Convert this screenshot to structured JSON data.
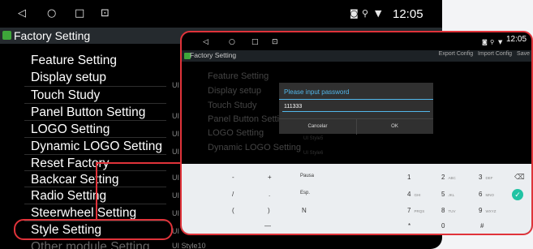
{
  "statusbar": {
    "nav_icons": [
      "◁",
      "○",
      "□",
      "⊡"
    ],
    "status_icons": [
      "◙",
      "⚲",
      "▼"
    ],
    "time": "12:05"
  },
  "titlebar": {
    "title": "Factory Setting"
  },
  "menu": {
    "items": [
      "Feature Setting",
      "Display setup",
      "Touch Study",
      "Panel Button Setting",
      "LOGO Setting",
      "Dynamic LOGO Setting",
      "Reset Factory",
      "Backcar Setting",
      "Radio Setting",
      "Steerwheel Setting",
      "Style Setting",
      "Other module Setting"
    ],
    "right_labels": [
      "UI",
      "UI",
      "UI",
      "UI",
      "UI",
      "UI",
      "UI",
      "UI",
      "UI",
      "UI",
      "UI Style10"
    ]
  },
  "overlay": {
    "time": "12:05",
    "title": "Factory Setting",
    "actions": [
      "Export Config",
      "Import Config",
      "Save"
    ],
    "menu_items": [
      "Feature Setting",
      "Display setup",
      "Touch Study",
      "Panel Button Setting",
      "LOGO Setting",
      "Dynamic LOGO Setting"
    ],
    "ui_labels": [
      "UI Style5",
      "UI Style6"
    ],
    "dialog": {
      "title": "Please input password",
      "value": "111333",
      "cancel": "Cancelar",
      "ok": "OK"
    },
    "keyboard": {
      "col1": [
        "-",
        "/",
        "(",
        ""
      ],
      "col2": [
        "+",
        ".",
        ")",
        "—"
      ],
      "col3": [
        "Pausa",
        "Esp.",
        "N",
        ""
      ],
      "numbers": [
        [
          {
            "n": "1",
            "l": ""
          },
          {
            "n": "2",
            "l": "ABC"
          },
          {
            "n": "3",
            "l": "DEF"
          }
        ],
        [
          {
            "n": "4",
            "l": "GHI"
          },
          {
            "n": "5",
            "l": "JKL"
          },
          {
            "n": "6",
            "l": "MNO"
          }
        ],
        [
          {
            "n": "7",
            "l": "PRQS"
          },
          {
            "n": "8",
            "l": "TUV"
          },
          {
            "n": "9",
            "l": "WXYZ"
          }
        ],
        [
          {
            "n": "*",
            "l": ""
          },
          {
            "n": "0",
            "l": ""
          },
          {
            "n": "#",
            "l": ""
          }
        ]
      ],
      "backspace": "⌫",
      "confirm": "✓"
    }
  },
  "colors": {
    "highlight": "#e0333a",
    "accent_blue": "#52b7ea",
    "check_green": "#21c3a4"
  }
}
